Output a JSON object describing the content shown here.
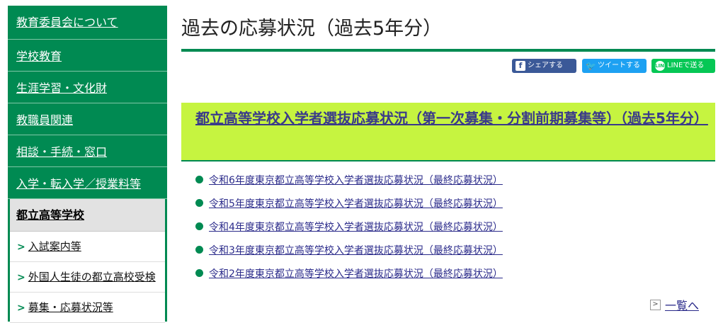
{
  "sidebar": {
    "items": [
      {
        "label": "教育委員会について"
      },
      {
        "label": "学校教育"
      },
      {
        "label": "生涯学習・文化財"
      },
      {
        "label": "教職員関連"
      },
      {
        "label": "相談・手続・窓口"
      },
      {
        "label": "入学・転入学／授業料等"
      }
    ],
    "current": "都立高等学校",
    "sub_items": [
      {
        "label": "入試案内等"
      },
      {
        "label": "外国人生徒の都立高校受検"
      },
      {
        "label": "募集・応募状況等"
      }
    ]
  },
  "main": {
    "page_title": "過去の応募状況（過去5年分）",
    "share": {
      "facebook": "シェアする",
      "twitter": "ツイートする",
      "line": "LINEで送る"
    },
    "section_heading": "都立高等学校入学者選抜応募状況（第一次募集・分割前期募集等）（過去5年分）",
    "links": [
      "令和6年度東京都立高等学校入学者選抜応募状況（最終応募状況）",
      "令和5年度東京都立高等学校入学者選抜応募状況（最終応募状況）",
      "令和4年度東京都立高等学校入学者選抜応募状況（最終応募状況）",
      "令和3年度東京都立高等学校入学者選抜応募状況（最終応募状況）",
      "令和2年度東京都立高等学校入学者選抜応募状況（最終応募状況）"
    ],
    "back_link": "一覧へ"
  },
  "colors": {
    "brand_green": "#008a52",
    "heading_bg": "#c6f440",
    "facebook": "#3b5998",
    "twitter": "#1da1f2",
    "line": "#06c755"
  }
}
